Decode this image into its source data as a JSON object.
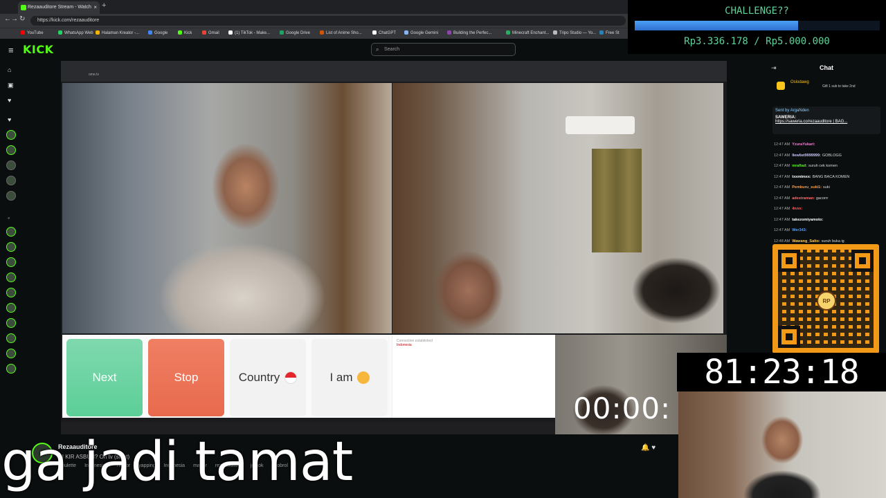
{
  "browser": {
    "tab_title": "Rezaauditore Stream - Watch",
    "tab_close": "×",
    "new_tab": "+",
    "url": "https://kick.com/rezaauditore",
    "nav": {
      "back": "←",
      "forward": "→",
      "reload": "↻"
    },
    "bookmarks": [
      {
        "label": "YouTube",
        "color": "#ff0000"
      },
      {
        "label": "WhatsApp Web",
        "color": "#25d366"
      },
      {
        "label": "Halaman Kreator -...",
        "color": "#f4b400"
      },
      {
        "label": "Google",
        "color": "#4285f4"
      },
      {
        "label": "Kick",
        "color": "#53fc18"
      },
      {
        "label": "Gmail",
        "color": "#ea4335"
      },
      {
        "label": "(1) TikTok - Make...",
        "color": "#ffffff"
      },
      {
        "label": "Google Drive",
        "color": "#1fa463"
      },
      {
        "label": "List of Anime Sho...",
        "color": "#d35400"
      },
      {
        "label": "ChatGPT",
        "color": "#ffffff"
      },
      {
        "label": "Google Gemini",
        "color": "#8ab4f8"
      },
      {
        "label": "Building the Perfec...",
        "color": "#8e44ad"
      },
      {
        "label": "Minecraft Enchant...",
        "color": "#27ae60"
      },
      {
        "label": "Tripo Studio — Yo...",
        "color": "#bbbbbb"
      },
      {
        "label": "Free St",
        "color": "#2980b9"
      }
    ]
  },
  "kick": {
    "logo": "KICK",
    "search_placeholder": "Search",
    "menu_icon": "≡"
  },
  "stream": {
    "inner_url": "ome.tv",
    "buttons": {
      "next": "Next",
      "stop": "Stop",
      "country": "Country",
      "iam": "I am"
    },
    "chat_notice": "Connection established",
    "chat_country": "Indonesia",
    "overlay_timer": "00:00:"
  },
  "chat": {
    "title": "Chat",
    "pinned_user": "Oslodawg",
    "pinned_text": "Gift 1 sub to take 2nd",
    "saweria_sent_by": "Sent by",
    "saweria_sender": "ArgaNden",
    "saweria_label": "SAWERIA:",
    "saweria_link": "https://saweria.co/rezaauditore | BAG...",
    "messages": [
      {
        "time": "12:47 AM",
        "user": "YzuraYukari:",
        "text": "",
        "color": "#ff7ad9"
      },
      {
        "time": "12:47 AM",
        "user": "llewliet9999999:",
        "text": "GOBLOGG",
        "color": "#c9c9ff"
      },
      {
        "time": "12:47 AM",
        "user": "mrafiad:",
        "text": "suruh cek komen",
        "color": "#53fc18"
      },
      {
        "time": "12:47 AM",
        "user": "txxmtmxx:",
        "text": "BANG BACA KOMEN",
        "color": "#ffffff"
      },
      {
        "time": "12:47 AM",
        "user": "Pemburu_suki1:",
        "text": "suki",
        "color": "#ff9f43"
      },
      {
        "time": "12:47 AM",
        "user": "adestraman:",
        "text": "gacorrr",
        "color": "#ff6b6b"
      },
      {
        "time": "12:47 AM",
        "user": "4nnn:",
        "text": "",
        "color": "#ff5c5c"
      },
      {
        "time": "12:47 AM",
        "user": "takezomiyamoto:",
        "text": "",
        "color": "#ffffff"
      },
      {
        "time": "12:47 AM",
        "user": "Wer343:",
        "text": "",
        "color": "#54a0ff"
      },
      {
        "time": "12:48 AM",
        "user": "Wawang_Salto:",
        "text": "suruh buka ig",
        "color": "#feca57"
      }
    ]
  },
  "qr": {
    "mascot_text": "RP"
  },
  "challenge": {
    "title": "CHALLENGE??",
    "amount": "Rp3.336.178 / Rp5.000.000",
    "progress": 0.667,
    "bar_color": "#3a86e8",
    "text_color": "#5fd39a"
  },
  "timer": {
    "value": "81:23:18"
  },
  "channel": {
    "name": "Rezaauditore",
    "title": "DI KIR ASBUN? On tv (strict)",
    "tags": [
      "Roulette",
      "Indonesian",
      "Horror",
      "yapping",
      "Indonesia",
      "mager",
      "rezaauditore",
      "jomok",
      "ngobrol"
    ]
  },
  "caption": {
    "text": "ga jadi tamat"
  },
  "accent": "#53fc18"
}
